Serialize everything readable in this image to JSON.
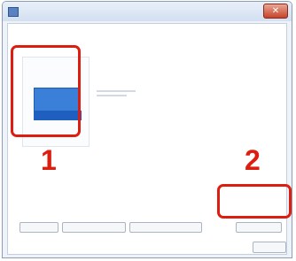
{
  "window": {
    "title": "",
    "close_glyph": "✕"
  },
  "dialog": {
    "instruction": "",
    "selected_item": {
      "caption": "",
      "value": "",
      "label": ""
    },
    "other_item": {
      "value": ""
    },
    "buttons": [
      {
        "label": ""
      },
      {
        "label": ""
      },
      {
        "label": ""
      },
      {
        "label": ""
      }
    ],
    "help_link": "",
    "close_label": ""
  },
  "callouts": {
    "first": "1",
    "second": "2",
    "color": "#dd1d0f"
  },
  "icons": {
    "window": "app-icon",
    "close": "close-icon"
  }
}
